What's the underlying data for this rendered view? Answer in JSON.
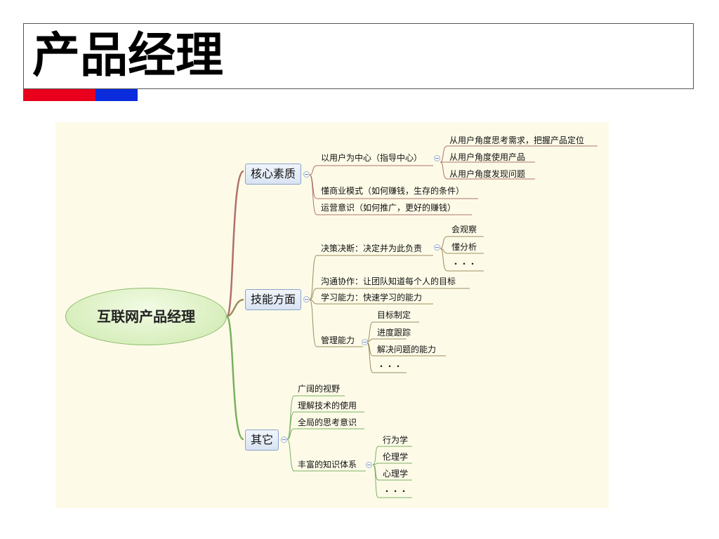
{
  "title": "产品经理",
  "mindmap": {
    "root": "互联网产品经理",
    "branches": [
      {
        "label": "核心素质",
        "children": [
          {
            "label": "以用户为中心（指导中心）",
            "children": [
              "从用户角度思考需求，把握产品定位",
              "从用户角度使用产品",
              "从用户角度发现问题"
            ]
          },
          {
            "label": "懂商业模式（如何赚钱，生存的条件）"
          },
          {
            "label": "运营意识（如何推广，更好的赚钱）"
          }
        ]
      },
      {
        "label": "技能方面",
        "children": [
          {
            "label": "决策决断：决定并为此负责",
            "children": [
              "会观察",
              "懂分析",
              "・・・"
            ]
          },
          {
            "label": "沟通协作：让团队知道每个人的目标"
          },
          {
            "label": "学习能力：快速学习的能力"
          },
          {
            "label": "管理能力",
            "children": [
              "目标制定",
              "进度跟踪",
              "解决问题的能力",
              "・・・"
            ]
          }
        ]
      },
      {
        "label": "其它",
        "children": [
          {
            "label": "广阔的视野"
          },
          {
            "label": "理解技术的使用"
          },
          {
            "label": "全局的思考意识"
          },
          {
            "label": "丰富的知识体系",
            "children": [
              "行为学",
              "伦理学",
              "心理学",
              "・・・"
            ]
          }
        ]
      }
    ]
  },
  "colors": {
    "red_bar": "#e8001c",
    "blue_bar": "#0a2cdc",
    "branch1_line": "#b07068",
    "branch2_line": "#9c8c60",
    "branch3_line": "#7ab060",
    "canvas_bg": "#fdfbe8"
  }
}
